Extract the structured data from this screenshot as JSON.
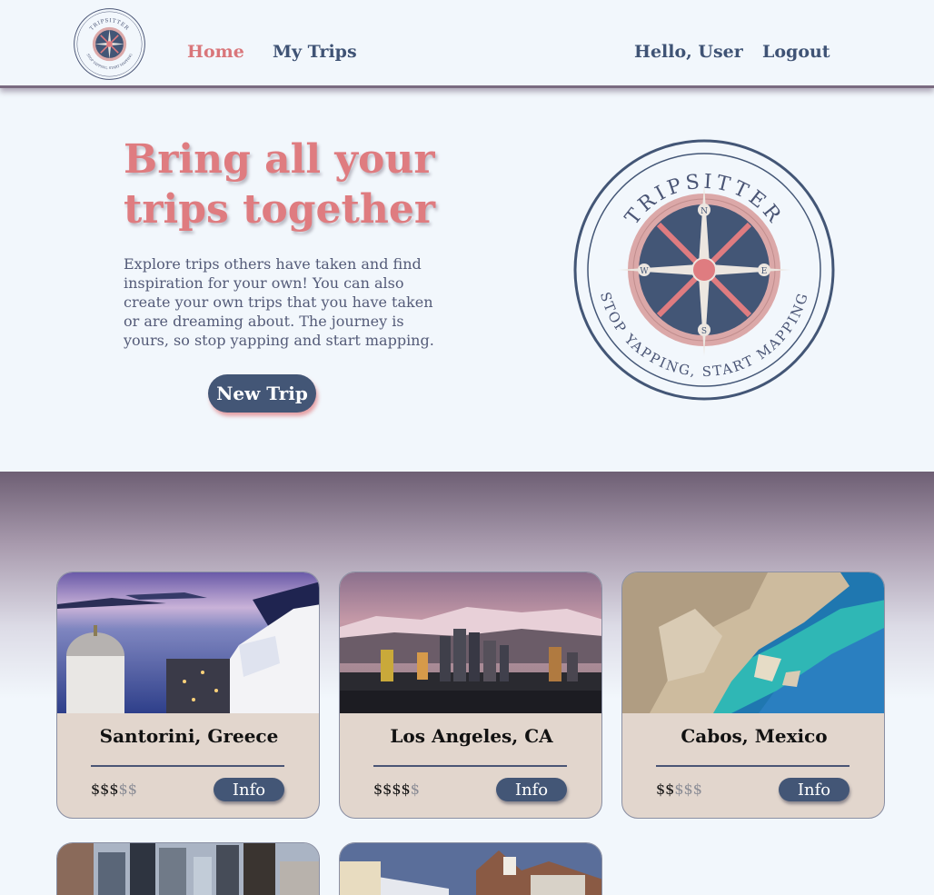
{
  "nav": {
    "logo_text_top": "TRIPSITTER",
    "logo_text_bottom": "STOP YAPPING, START MAPPING",
    "links": {
      "home": "Home",
      "my_trips": "My Trips",
      "hello": "Hello, User",
      "logout": "Logout"
    }
  },
  "hero": {
    "title_line1": "Bring all your",
    "title_line2": "trips together",
    "body": "Explore trips others have taken and find inspiration for your own! You can also create your own trips that you have taken or are dreaming about. The journey is yours, so stop yapping and start mapping.",
    "new_trip_label": "New Trip",
    "logo_text_top": "TRIPSITTER",
    "logo_text_bottom": "STOP YAPPING, START MAPPING",
    "compass_n": "N",
    "compass_s": "S",
    "compass_e": "E",
    "compass_w": "W"
  },
  "colors": {
    "accent_pink": "#df7c80",
    "navy": "#435676",
    "card_bg": "#e2d6cd",
    "page_bg": "#f2f7fc"
  },
  "trips": [
    {
      "title": "Santorini, Greece",
      "price_on": "$$$",
      "price_off": "$$",
      "info_label": "Info"
    },
    {
      "title": "Los Angeles, CA",
      "price_on": "$$$$",
      "price_off": "$",
      "info_label": "Info"
    },
    {
      "title": "Cabos, Mexico",
      "price_on": "$$",
      "price_off": "$$$",
      "info_label": "Info"
    }
  ]
}
